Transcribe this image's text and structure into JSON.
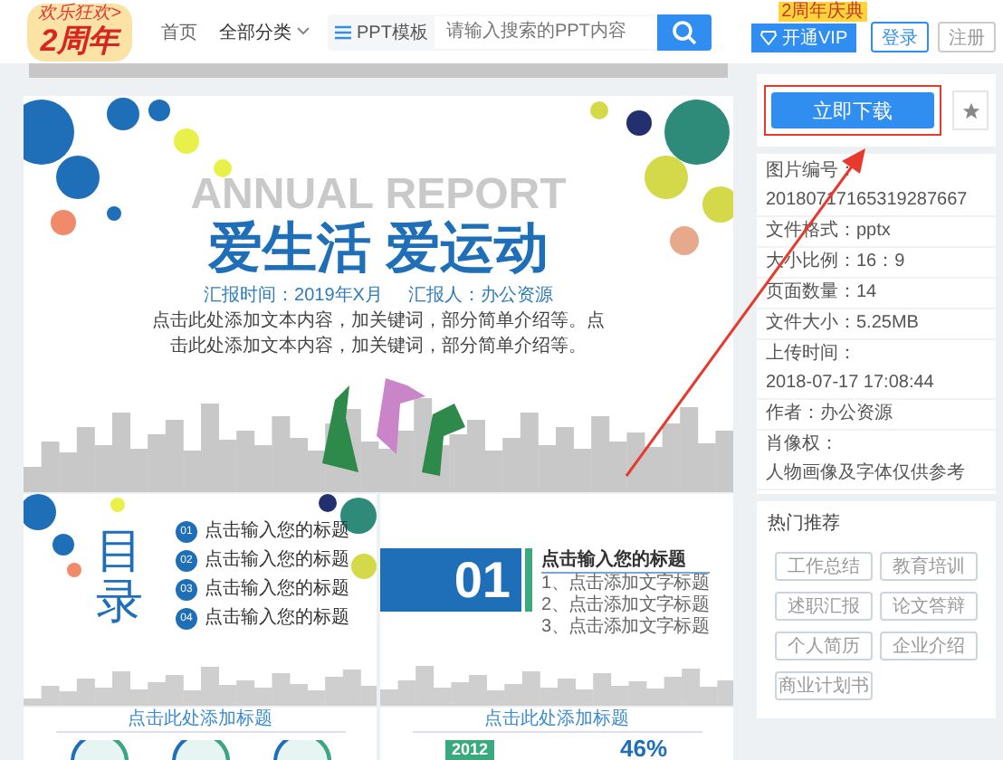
{
  "header": {
    "logo_badge": "欢乐狂欢>",
    "logo_text": "2周年",
    "nav": [
      "首页",
      "全部分类"
    ],
    "search": {
      "category": "PPT模板",
      "placeholder": "请输入搜索的PPT内容"
    },
    "vip_button": "开通VIP",
    "vip_badge": "2周年庆典",
    "login": "登录",
    "register": "注册"
  },
  "preview": {
    "cover": {
      "title_en": "ANNUAL REPORT",
      "title_cn": "爱生活 爱运动",
      "meta": [
        "汇报时间：2019年X月",
        "汇报人：办公资源"
      ],
      "body": "点击此处添加文本内容，加关键词，部分简单介绍等。点击此处添加文本内容，加关键词，部分简单介绍等。"
    },
    "toc": {
      "title": "目录",
      "items": [
        {
          "number": "01",
          "text": "点击输入您的标题"
        },
        {
          "number": "02",
          "text": "点击输入您的标题"
        },
        {
          "number": "03",
          "text": "点击输入您的标题"
        },
        {
          "number": "04",
          "text": "点击输入您的标题"
        }
      ]
    },
    "section": {
      "number": "01",
      "title": "点击输入您的标题",
      "items": [
        "1、点击添加文字标题",
        "2、点击添加文字标题",
        "3、点击添加文字标题"
      ]
    },
    "bottom_left": {
      "title": "点击此处添加标题"
    },
    "bottom_right": {
      "title": "点击此处添加标题",
      "year": "2012",
      "percent": "46%"
    }
  },
  "sidebar": {
    "download": "立即下载",
    "info": [
      {
        "label": "图片编号：",
        "value": "20180717165319287667"
      },
      {
        "label": "文件格式：",
        "value": "pptx"
      },
      {
        "label": "大小比例：",
        "value": "16：9"
      },
      {
        "label": "页面数量：",
        "value": "14"
      },
      {
        "label": "文件大小：",
        "value": "5.25MB"
      },
      {
        "label": "上传时间：",
        "value": "2018-07-17 17:08:44"
      },
      {
        "label": "作者：",
        "value": "办公资源"
      },
      {
        "label": "肖像权：",
        "value": "人物画像及字体仅供参考"
      }
    ],
    "hot_title": "热门推荐",
    "hot_tags": [
      "工作总结",
      "教育培训",
      "述职汇报",
      "论文答辩",
      "个人简历",
      "企业介绍",
      "商业计划书"
    ]
  }
}
